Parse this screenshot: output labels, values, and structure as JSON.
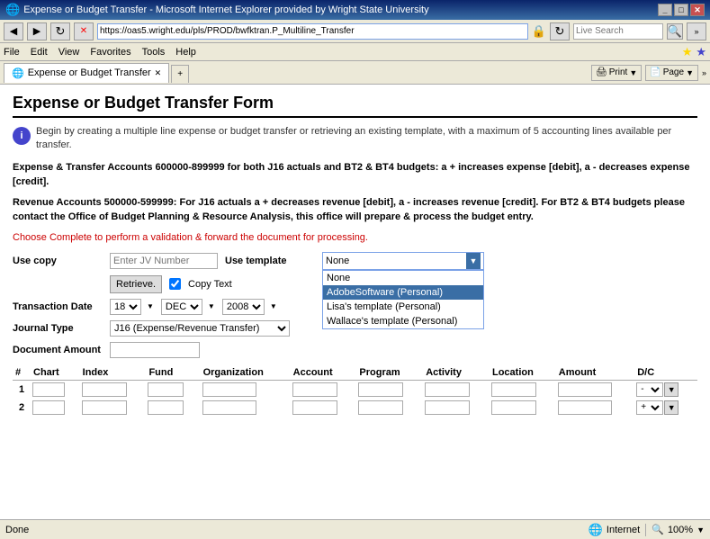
{
  "titlebar": {
    "title": "Expense or Budget Transfer - Microsoft Internet Explorer provided by Wright State University",
    "icon": "IE"
  },
  "addressbar": {
    "url": "https://oas5.wright.edu/pls/PROD/bwfktran.P_Multiline_Transfer",
    "search_placeholder": "Live Search"
  },
  "menubar": {
    "items": [
      "File",
      "Edit",
      "View",
      "Favorites",
      "Tools",
      "Help"
    ]
  },
  "tabbar": {
    "tab_label": "Expense or Budget Transfer",
    "print_label": "Print",
    "page_label": "Page"
  },
  "page": {
    "title": "Expense or Budget Transfer Form",
    "info_text": "Begin by creating a multiple line expense or budget transfer or retrieving an existing template, with a maximum of 5 accounting lines available per transfer.",
    "instructions": [
      "Expense & Transfer Accounts 600000-899999 for both J16 actuals and BT2 & BT4 budgets: a + increases expense [debit], a - decreases expense [credit].",
      "Revenue Accounts 500000-599999: For J16 actuals a + decreases revenue [debit], a - increases revenue [credit]. For BT2 & BT4 budgets please contact the Office of Budget Planning & Resource Analysis, this office will prepare & process the budget entry."
    ],
    "choose_text": "Choose Complete to perform a validation & forward the document for processing."
  },
  "form": {
    "use_copy_label": "Use copy",
    "use_copy_placeholder": "Enter JV Number",
    "retrieve_label": "Retrieve.",
    "copy_text_label": "Copy Text",
    "use_template_label": "Use template",
    "template_current": "None",
    "template_options": [
      "None",
      "AdobeSoftware (Personal)",
      "Lisa's template (Personal)",
      "Wallace's template (Personal)"
    ],
    "template_selected": "AdobeSoftware (Personal)",
    "transaction_date_label": "Transaction Date",
    "day": "18",
    "month": "DEC",
    "year": "2008",
    "journal_type_label": "Journal Type",
    "journal_value": "J16 (Expense/Revenue Transfer)",
    "document_amount_label": "Document Amount"
  },
  "table": {
    "columns": [
      "#",
      "Chart",
      "Index",
      "Fund",
      "Organization",
      "Account",
      "Program",
      "Activity",
      "Location",
      "Amount",
      "D/C"
    ],
    "rows": [
      {
        "num": "1"
      },
      {
        "num": "2"
      }
    ]
  },
  "statusbar": {
    "status": "Done",
    "zone": "Internet",
    "zoom": "100%"
  }
}
